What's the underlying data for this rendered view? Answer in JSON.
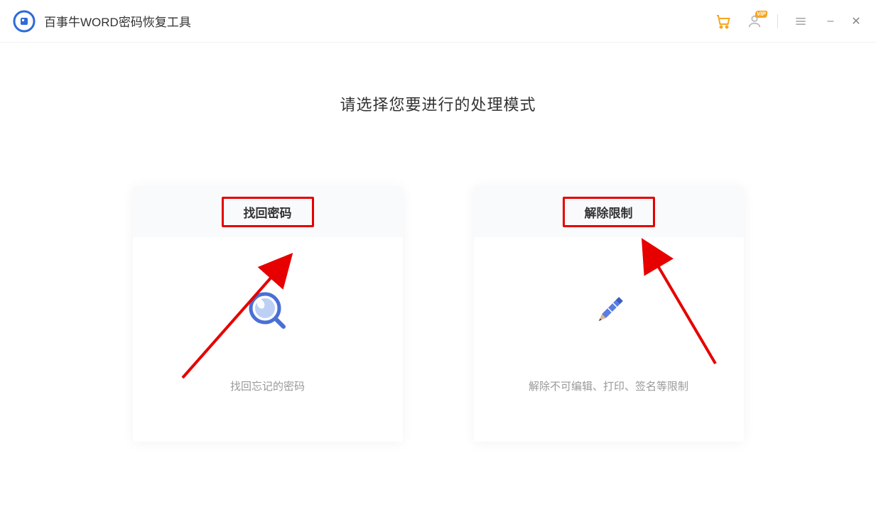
{
  "app": {
    "title": "百事牛WORD密码恢复工具"
  },
  "titlebar": {
    "cart_icon": "cart",
    "vip_icon": "user",
    "vip_badge": "VIP",
    "menu_icon": "menu",
    "minimize": "–",
    "close": "✕"
  },
  "main": {
    "heading": "请选择您要进行的处理模式",
    "cards": [
      {
        "title": "找回密码",
        "desc": "找回忘记的密码",
        "icon": "magnifier"
      },
      {
        "title": "解除限制",
        "desc": "解除不可编辑、打印、签名等限制",
        "icon": "pencil"
      }
    ]
  },
  "annotations": {
    "highlight_color": "#e60000",
    "arrow_color": "#e60000"
  }
}
